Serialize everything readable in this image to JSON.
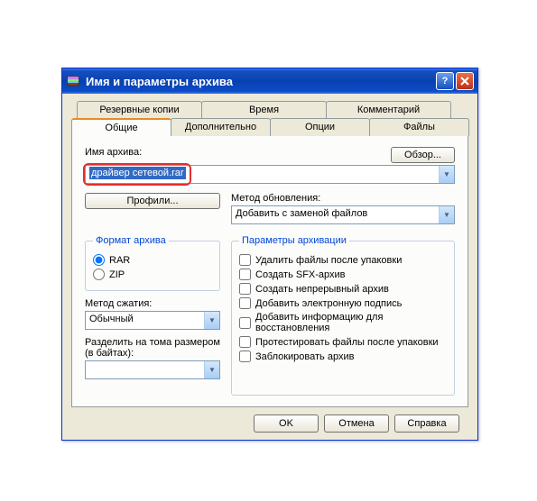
{
  "window": {
    "title": "Имя и параметры архива"
  },
  "tabs": {
    "row1": [
      "Резервные копии",
      "Время",
      "Комментарий"
    ],
    "row2": [
      "Общие",
      "Дополнительно",
      "Опции",
      "Файлы"
    ],
    "active": "Общие"
  },
  "archive": {
    "name_label": "Имя архива:",
    "name_value": "драйвер сетевой.rar",
    "browse_label": "Обзор..."
  },
  "profiles_label": "Профили...",
  "update": {
    "label": "Метод обновления:",
    "value": "Добавить с заменой файлов"
  },
  "format": {
    "legend": "Формат архива",
    "rar": "RAR",
    "zip": "ZIP",
    "selected": "RAR"
  },
  "compression": {
    "label": "Метод сжатия:",
    "value": "Обычный"
  },
  "split": {
    "label": "Разделить на тома размером (в байтах):",
    "value": ""
  },
  "params": {
    "legend": "Параметры архивации",
    "items": [
      "Удалить файлы после упаковки",
      "Создать SFX-архив",
      "Создать непрерывный архив",
      "Добавить электронную подпись",
      "Добавить информацию для восстановления",
      "Протестировать файлы после упаковки",
      "Заблокировать архив"
    ]
  },
  "footer": {
    "ok": "OK",
    "cancel": "Отмена",
    "help": "Справка"
  }
}
